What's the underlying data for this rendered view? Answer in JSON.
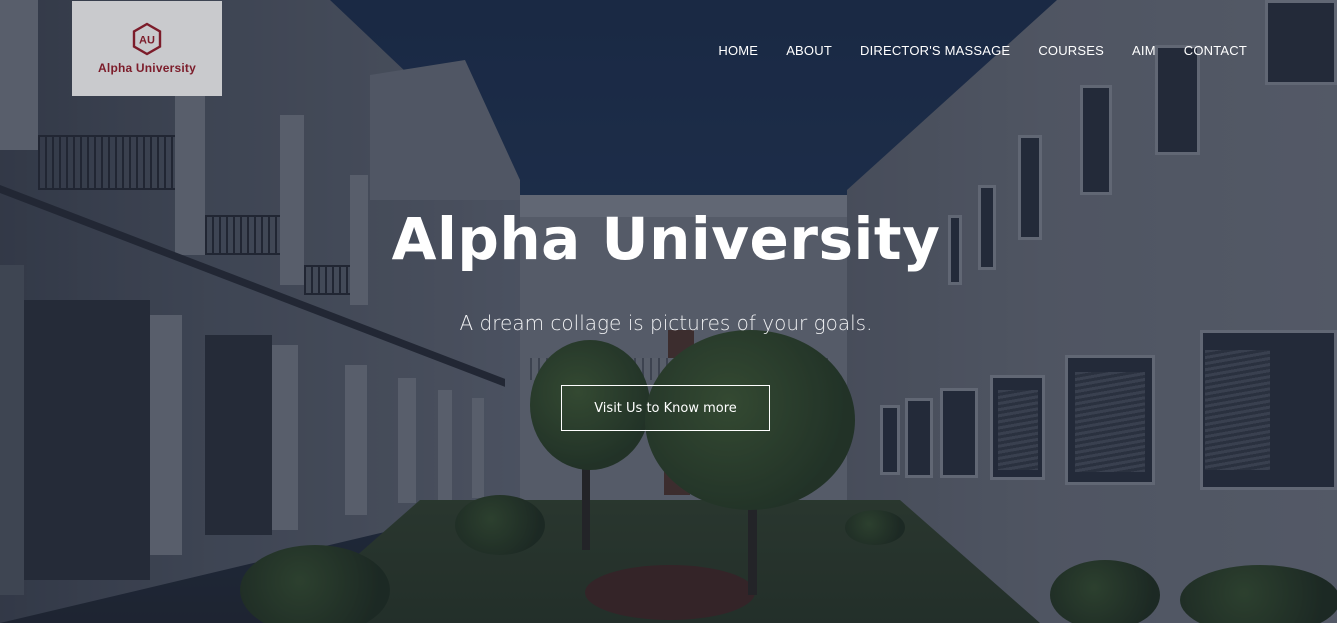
{
  "brand": {
    "name": "Alpha University",
    "monogram": "AU",
    "logo_color": "#7c1c2a"
  },
  "nav": {
    "items": [
      {
        "label": "HOME"
      },
      {
        "label": "ABOUT"
      },
      {
        "label": "DIRECTOR'S MASSAGE"
      },
      {
        "label": "COURSES"
      },
      {
        "label": "AIM"
      },
      {
        "label": "CONTACT"
      }
    ]
  },
  "hero": {
    "title": "Alpha University",
    "subtitle": "A dream collage is pictures of your goals.",
    "cta_label": "Visit Us to Know more",
    "background": "campus-courtyard-photo",
    "overlay_color": "#141c30"
  }
}
